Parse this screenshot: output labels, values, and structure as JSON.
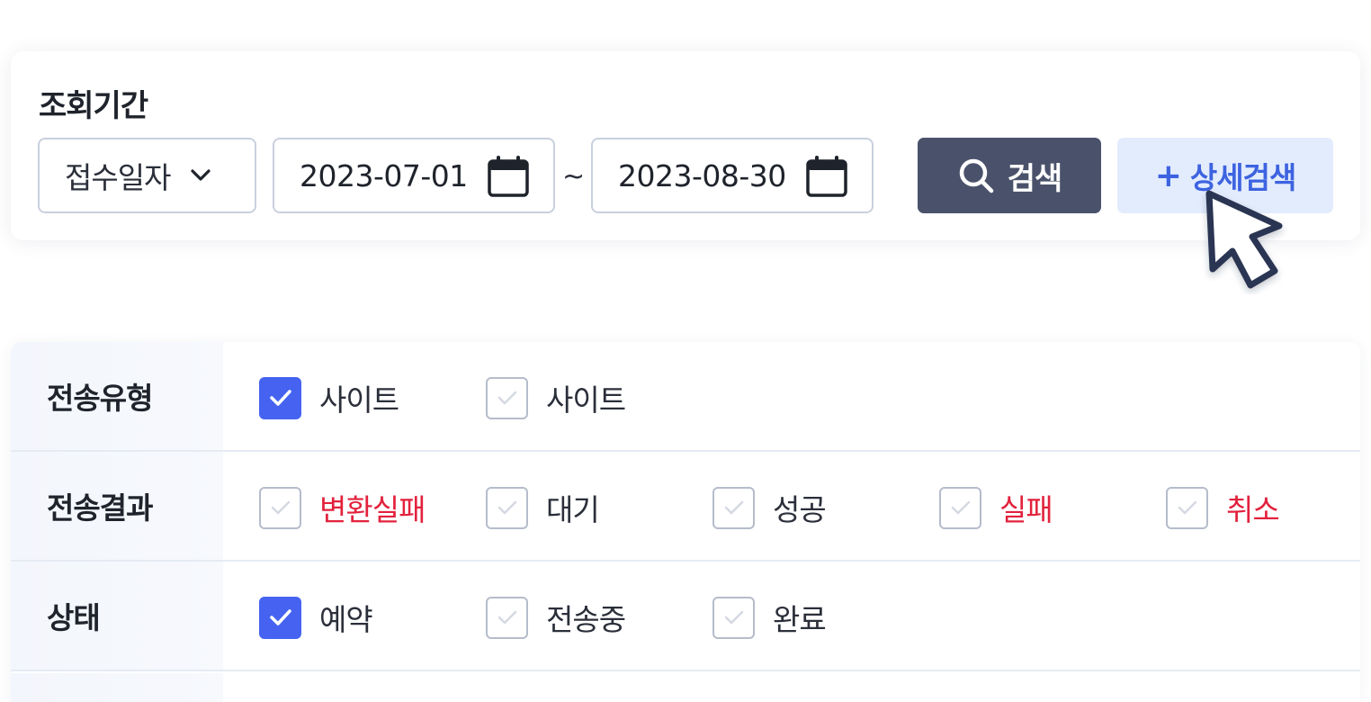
{
  "search": {
    "period_label": "조회기간",
    "date_type": {
      "value": "접수일자",
      "icon": "chevron-down-icon"
    },
    "date_from": "2023-07-01",
    "date_to": "2023-08-30",
    "separator": "~",
    "search_button": "검색",
    "advanced_button": {
      "plus": "+",
      "label": "상세검색"
    }
  },
  "filters": {
    "transfer_type": {
      "label": "전송유형",
      "options": [
        {
          "label": "사이트",
          "checked": true
        },
        {
          "label": "사이트",
          "checked": false
        }
      ]
    },
    "transfer_result": {
      "label": "전송결과",
      "options": [
        {
          "label": "변환실패",
          "checked": false,
          "color": "#e2223d"
        },
        {
          "label": "대기",
          "checked": false
        },
        {
          "label": "성공",
          "checked": false
        },
        {
          "label": "실패",
          "checked": false,
          "color": "#e2223d"
        },
        {
          "label": "취소",
          "checked": false,
          "color": "#e2223d"
        }
      ]
    },
    "status": {
      "label": "상태",
      "options": [
        {
          "label": "예약",
          "checked": true
        },
        {
          "label": "전송중",
          "checked": false
        },
        {
          "label": "완료",
          "checked": false
        }
      ]
    }
  },
  "colors": {
    "primary": "#4563f0",
    "search_button_bg": "#4a526b",
    "advanced_button_bg": "#e3ecfd",
    "advanced_button_text": "#3d63e0",
    "error_text": "#e2223d"
  }
}
